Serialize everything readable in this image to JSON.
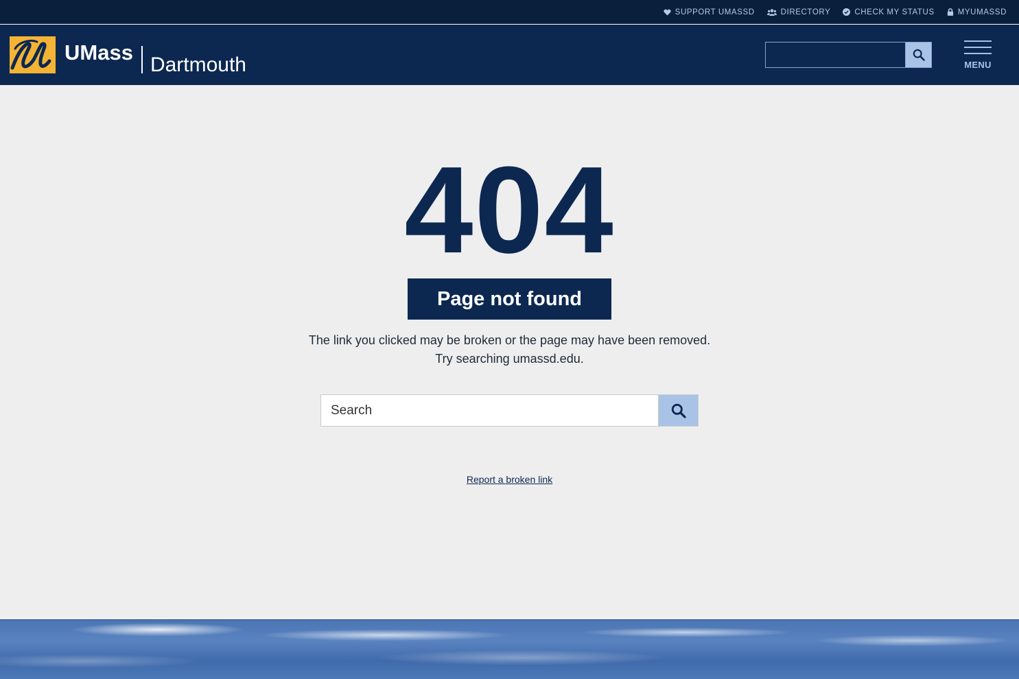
{
  "utility_nav": {
    "items": [
      {
        "label": "SUPPORT UMASSD",
        "icon": "heart-icon"
      },
      {
        "label": "DIRECTORY",
        "icon": "users-icon"
      },
      {
        "label": "CHECK MY STATUS",
        "icon": "check-circle-icon"
      },
      {
        "label": "MYUMASSD",
        "icon": "lock-icon"
      }
    ]
  },
  "header": {
    "logo": {
      "primary": "UMass",
      "secondary": "Dartmouth",
      "mark_icon": "umass-u-logo-icon"
    },
    "search": {
      "placeholder": "",
      "button_icon": "search-icon"
    },
    "menu_label": "MENU"
  },
  "error": {
    "code": "404",
    "title": "Page not found",
    "message_line1": "The link you clicked may be broken or the page may have been removed.",
    "message_line2": "Try searching umassd.edu."
  },
  "main_search": {
    "placeholder": "Search",
    "button_icon": "search-icon"
  },
  "report_link": "Report a broken link",
  "colors": {
    "navy": "#0c2851",
    "utility_bar": "#0a1f3c",
    "gold": "#f5b335",
    "light_blue": "#a8c3e6",
    "background": "#eeeeee"
  }
}
